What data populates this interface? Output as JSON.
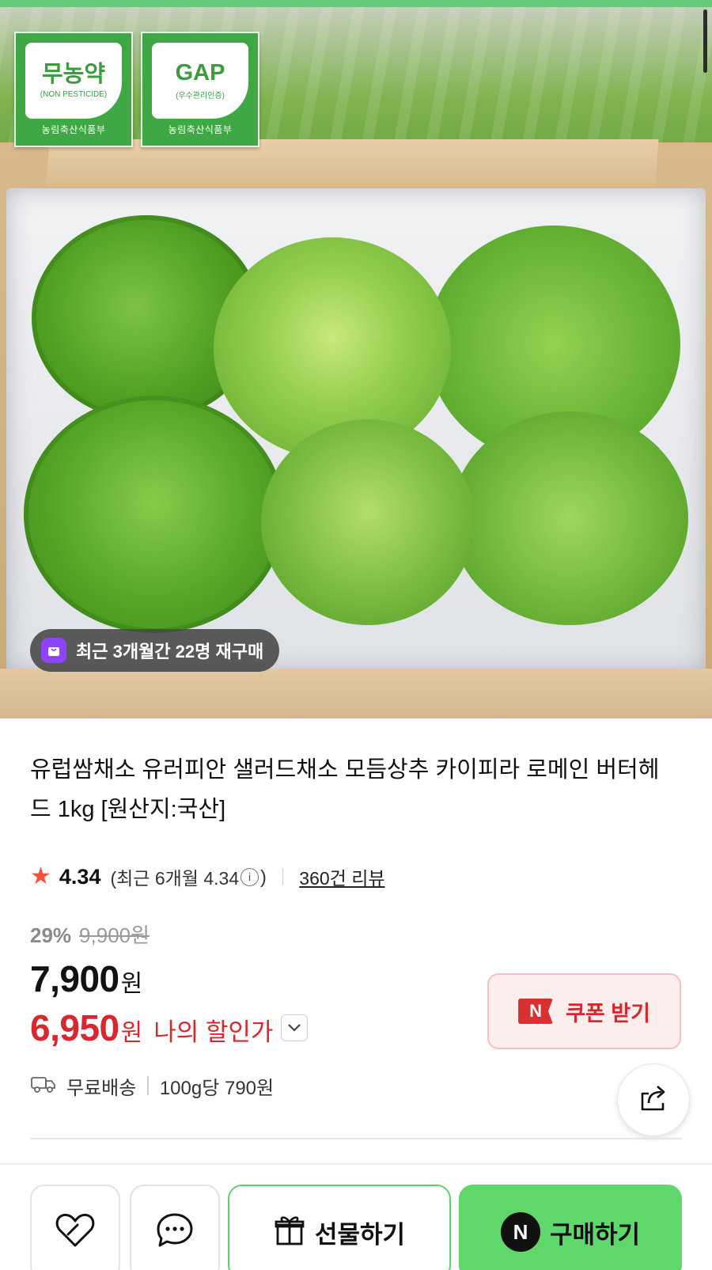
{
  "product_image": {
    "certifications": [
      {
        "main": "무농약",
        "sub": "(NON PESTICIDE)",
        "issuer": "농림축산식품부"
      },
      {
        "main": "GAP",
        "sub": "(우수관리인증)",
        "issuer": "농림축산식품부"
      }
    ],
    "repurchase_text": "최근 3개월간 22명 재구매"
  },
  "product": {
    "title": "유럽쌈채소 유러피안 샐러드채소 모듬상추 카이피라 로메인 버터헤드 1kg [원산지:국산]"
  },
  "rating": {
    "value": "4.34",
    "recent_prefix": "(최근 6개월 4.34",
    "recent_suffix": ")",
    "review_link": "360건 리뷰"
  },
  "pricing": {
    "discount_percent": "29%",
    "original_price": "9,900원",
    "price": "7,900",
    "price_unit": "원",
    "my_price": "6,950",
    "my_price_unit": "원",
    "my_price_label": "나의 할인가"
  },
  "coupon": {
    "badge": "N",
    "label": "쿠폰 받기"
  },
  "shipping": {
    "label": "무료배송",
    "unit_price": "100g당 790원"
  },
  "actions": {
    "gift_label": "선물하기",
    "buy_badge": "N",
    "buy_label": "구매하기"
  },
  "colors": {
    "accent_green": "#5fd76b",
    "discount_red": "#d6282e",
    "badge_green": "#3fa845",
    "repurchase_icon": "#8e44ff"
  },
  "icons": [
    "star-icon",
    "info-icon",
    "chevron-down-icon",
    "delivery-truck-icon",
    "share-icon",
    "heart-icon",
    "chat-bubble-icon",
    "gift-icon",
    "naver-n-icon",
    "shopping-bag-icon"
  ]
}
